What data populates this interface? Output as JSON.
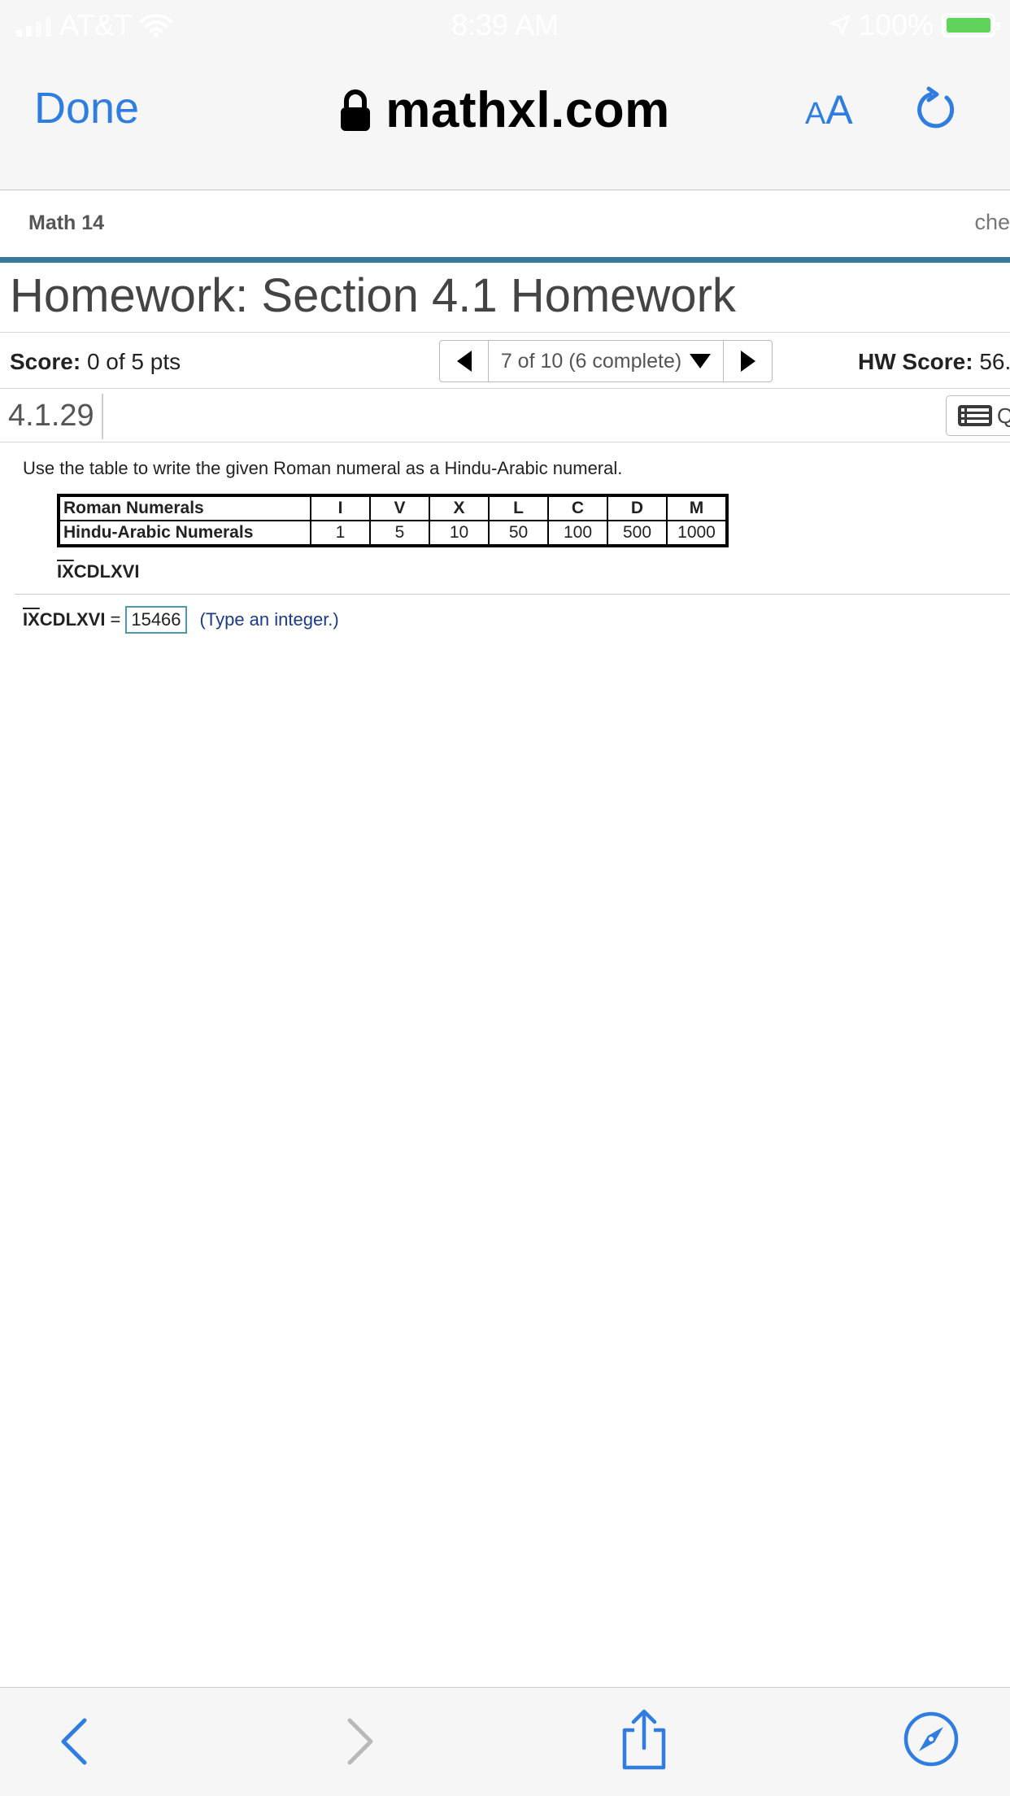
{
  "status_bar": {
    "carrier": "AT&T",
    "time": "8:39 AM",
    "battery": "100%"
  },
  "browser": {
    "done_label": "Done",
    "url": "mathxl.com",
    "text_size_label": "AA"
  },
  "course": {
    "name": "Math 14",
    "right_text": "che"
  },
  "homework": {
    "title": "Homework: Section 4.1 Homework",
    "score_label": "Score:",
    "score_value": "0 of 5 pts",
    "question_nav": "7 of 10 (6 complete)",
    "hw_score_label": "HW Score:",
    "hw_score_value": "56."
  },
  "question": {
    "id": "4.1.29",
    "list_button": "Q",
    "instructions": "Use the table to write the given Roman numeral as a Hindu-Arabic numeral.",
    "table": {
      "rows": [
        [
          "Roman Numerals",
          "I",
          "V",
          "X",
          "L",
          "C",
          "D",
          "M"
        ],
        [
          "Hindu-Arabic Numerals",
          "1",
          "5",
          "10",
          "50",
          "100",
          "500",
          "1000"
        ]
      ]
    },
    "numeral_overlined": "IX",
    "numeral_rest": "CDLXVI",
    "answer_value": "15466",
    "equals": "=",
    "hint": "(Type an integer.)"
  },
  "colors": {
    "ios_blue": "#2f7de1",
    "accent_bar": "#357a9a",
    "answer_border": "#4b9aa8",
    "hint_text": "#1a3a8a"
  },
  "icons": [
    "lock-icon",
    "reload-icon",
    "back-icon",
    "forward-icon",
    "share-icon",
    "compass-icon",
    "wifi-icon",
    "location-icon",
    "list-icon"
  ]
}
